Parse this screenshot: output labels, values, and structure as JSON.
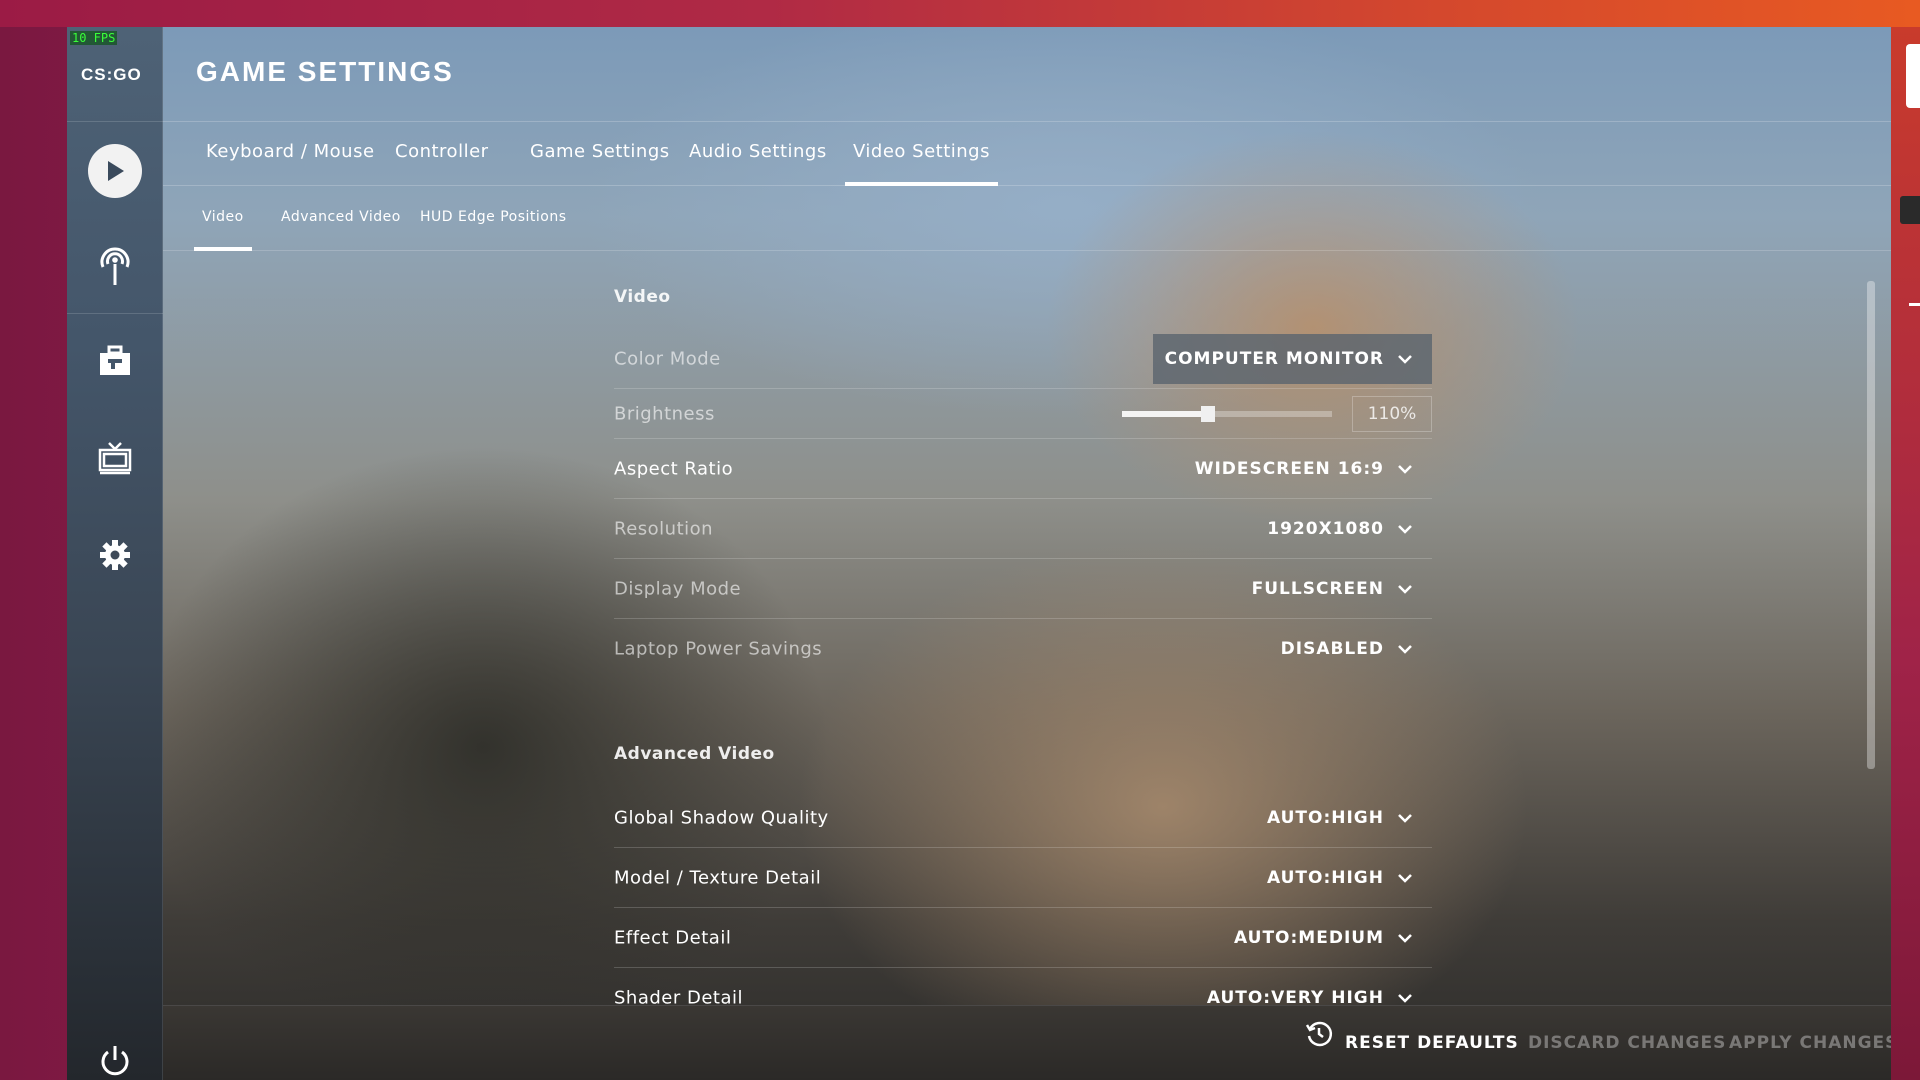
{
  "fps_counter": "10 FPS",
  "app": {
    "logo_text": "CS:GO"
  },
  "header": {
    "title": "GAME SETTINGS"
  },
  "tabs": [
    {
      "label": "Keyboard / Mouse"
    },
    {
      "label": "Controller"
    },
    {
      "label": "Game Settings"
    },
    {
      "label": "Audio Settings"
    },
    {
      "label": "Video Settings",
      "active": true
    }
  ],
  "subtabs": [
    {
      "label": "Video",
      "active": true
    },
    {
      "label": "Advanced Video"
    },
    {
      "label": "HUD Edge Positions"
    }
  ],
  "sidebar": {
    "icons": [
      "play-icon",
      "broadcast-icon",
      "inventory-briefcase-icon",
      "watch-tv-icon",
      "settings-gear-icon",
      "power-icon"
    ]
  },
  "video_section": {
    "title": "Video",
    "color_mode": {
      "label": "Color Mode",
      "value": "COMPUTER MONITOR"
    },
    "brightness": {
      "label": "Brightness",
      "value": "110%",
      "fraction": 0.41
    },
    "aspect_ratio": {
      "label": "Aspect Ratio",
      "value": "WIDESCREEN 16:9"
    },
    "resolution": {
      "label": "Resolution",
      "value": "1920X1080"
    },
    "display_mode": {
      "label": "Display Mode",
      "value": "FULLSCREEN"
    },
    "laptop_power": {
      "label": "Laptop Power Savings",
      "value": "DISABLED"
    }
  },
  "advanced_section": {
    "title": "Advanced Video",
    "shadow": {
      "label": "Global Shadow Quality",
      "value": "AUTO:HIGH"
    },
    "texture": {
      "label": "Model / Texture Detail",
      "value": "AUTO:HIGH"
    },
    "effect": {
      "label": "Effect Detail",
      "value": "AUTO:MEDIUM"
    },
    "shader": {
      "label": "Shader Detail",
      "value": "AUTO:VERY HIGH"
    }
  },
  "footer": {
    "reset": "RESET DEFAULTS",
    "discard": "DISCARD CHANGES",
    "apply": "APPLY CHANGES"
  }
}
